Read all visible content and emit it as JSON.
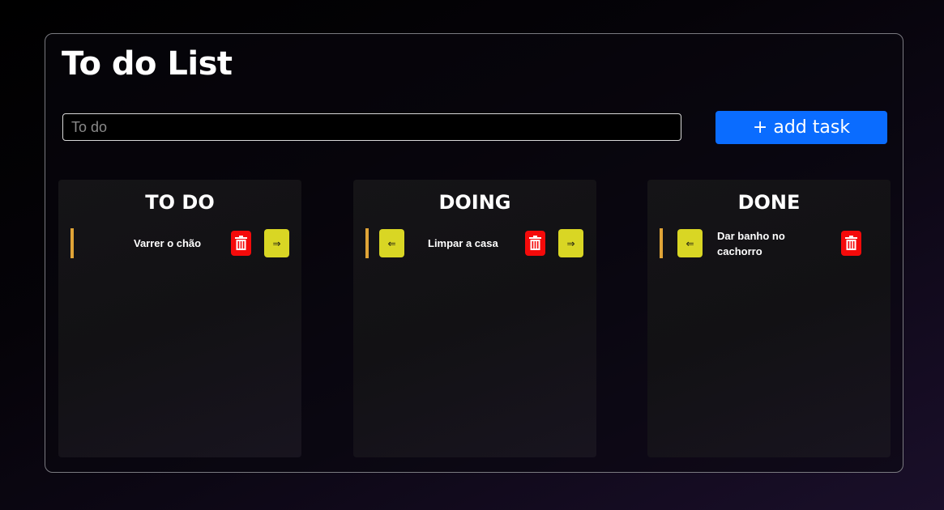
{
  "header": {
    "title": "To do List"
  },
  "form": {
    "input_placeholder": "To do",
    "input_value": "",
    "add_label": "+ add task"
  },
  "columns": [
    {
      "title": "TO DO",
      "tasks": [
        {
          "text": "Varrer o chão",
          "prev_label": "",
          "next_label": "⇒"
        }
      ]
    },
    {
      "title": "DOING",
      "tasks": [
        {
          "text": "Limpar a casa",
          "prev_label": "⇐",
          "next_label": "⇒"
        }
      ]
    },
    {
      "title": "DONE",
      "tasks": [
        {
          "text": "Dar banho no cachorro",
          "prev_label": "⇐",
          "next_label": ""
        }
      ]
    }
  ],
  "icons": {
    "delete": "trash-icon"
  },
  "colors": {
    "accent_blue": "#0a6cff",
    "delete_red": "#f50a0a",
    "move_yellow": "#d9d624",
    "task_marker": "#e0a437"
  }
}
